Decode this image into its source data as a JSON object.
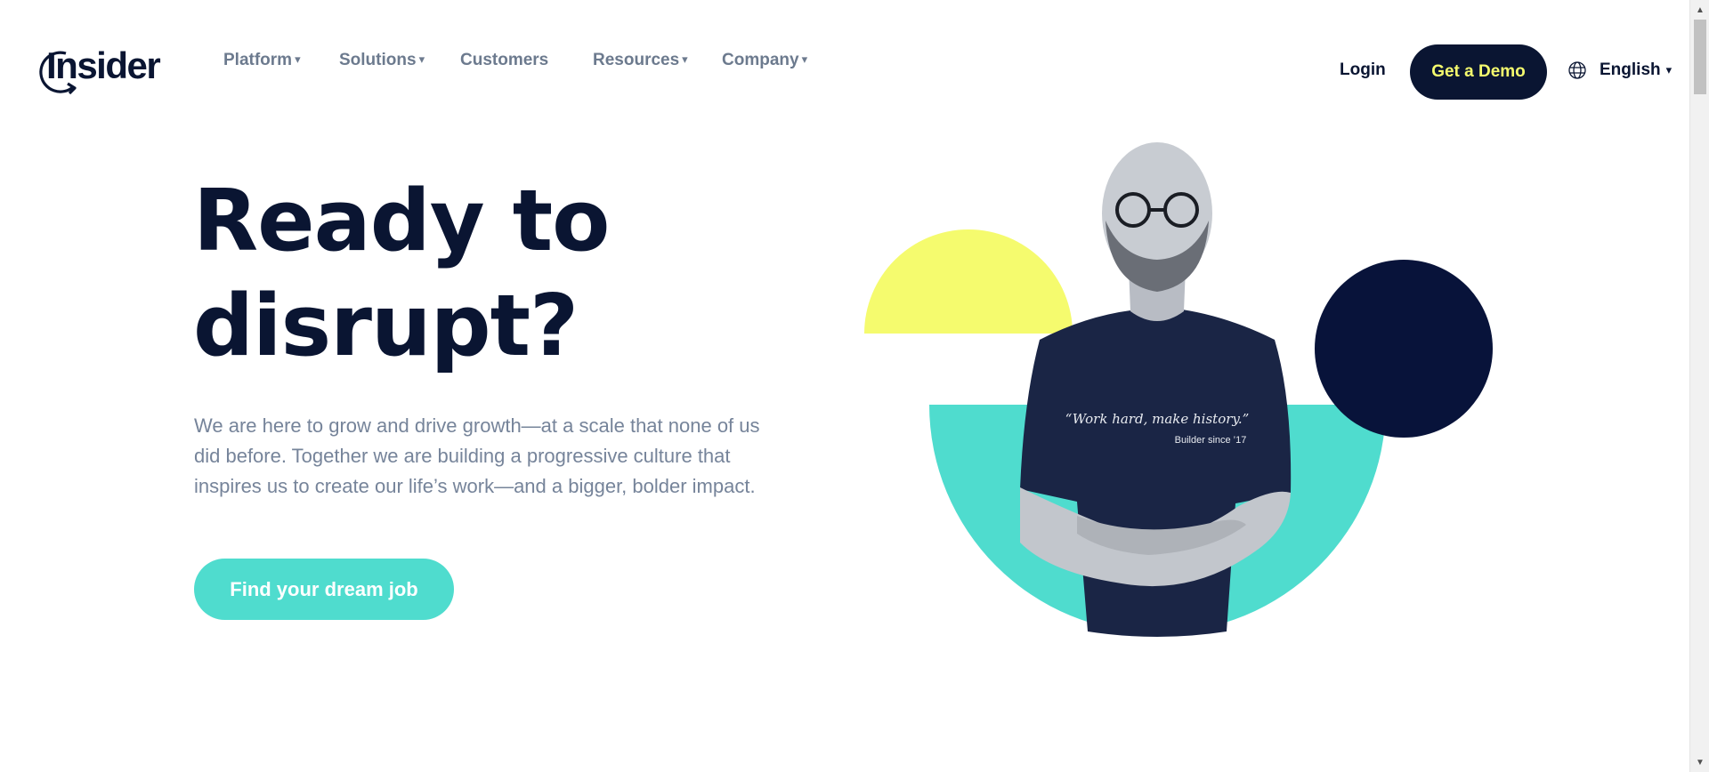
{
  "nav": {
    "logo": "Insider",
    "items": [
      {
        "label": "Platform",
        "has_dropdown": true
      },
      {
        "label": "Solutions",
        "has_dropdown": true
      },
      {
        "label": "Customers",
        "has_dropdown": false
      },
      {
        "label": "Resources",
        "has_dropdown": true
      },
      {
        "label": "Company",
        "has_dropdown": true
      }
    ],
    "caret": "▾",
    "login": "Login",
    "demo": "Get a Demo",
    "language": "English",
    "language_icon": "globe-icon"
  },
  "hero": {
    "title_line1": "Ready to",
    "title_line2": "disrupt?",
    "description_line1": "We are here to grow and drive growth—at a scale that none of us",
    "description_line2": "did before. Together we are building a progressive culture that",
    "description_line3": "inspires us to create our life’s work—and a bigger, bolder impact.",
    "cta": "Find your dream job"
  },
  "illustration": {
    "shirt_quote": "“Work hard, make history.”",
    "shirt_sub": "Builder since ’17"
  },
  "colors": {
    "navy": "#0a1532",
    "teal": "#4fdcce",
    "yellow": "#f5fb6e",
    "muted_text": "#76849a",
    "nav_text": "#6c7a8e"
  },
  "scrollbar": {
    "up_arrow": "▲",
    "down_arrow": "▼"
  }
}
